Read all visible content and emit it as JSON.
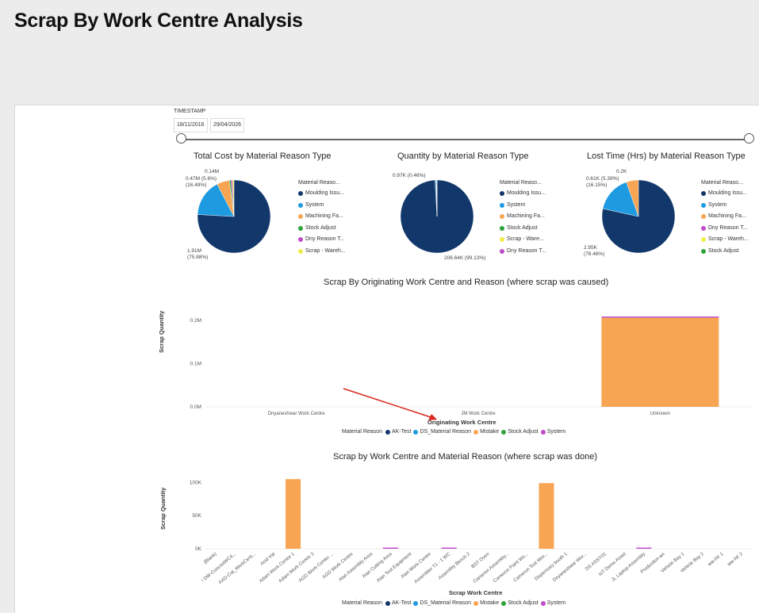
{
  "page": {
    "title": "Scrap By Work Centre Analysis"
  },
  "slicer": {
    "label": "TIMESTAMP",
    "start_date": "18/11/2016",
    "end_date": "29/04/2026"
  },
  "colors": {
    "dark_blue": "#12386b",
    "blue": "#1e9ae0",
    "orange": "#f7a552",
    "green": "#2ea33a",
    "purple": "#c04cc8",
    "yellow": "#f0ee4a",
    "arrow": "#d9281e"
  },
  "pies": [
    {
      "title": "Total Cost by Material Reason Type",
      "legend_title": "Material Reaso...",
      "legend": [
        {
          "label": "Moulding Issu...",
          "color": "#12386b"
        },
        {
          "label": "System",
          "color": "#1e9ae0"
        },
        {
          "label": "Machining Fa...",
          "color": "#f7a552"
        },
        {
          "label": "Stock Adjust",
          "color": "#2ea33a"
        },
        {
          "label": "Dny Reason T...",
          "color": "#c04cc8"
        },
        {
          "label": "Scrap - Wareh...",
          "color": "#f0ee4a"
        }
      ],
      "labels": {
        "top": "0.14M",
        "upper_1": "0.47M (5.6%)",
        "upper_2": "(16.48%)",
        "bottom_1": "1.91M",
        "bottom_2": "(75.88%)"
      }
    },
    {
      "title": "Quantity by Material Reason Type",
      "legend_title": "Material Reaso...",
      "legend": [
        {
          "label": "Moulding Issu...",
          "color": "#12386b"
        },
        {
          "label": "System",
          "color": "#1e9ae0"
        },
        {
          "label": "Machining Fa...",
          "color": "#f7a552"
        },
        {
          "label": "Stock Adjust",
          "color": "#2ea33a"
        },
        {
          "label": "Scrap - Ware...",
          "color": "#f0ee4a"
        },
        {
          "label": "Dny Reason T...",
          "color": "#c04cc8"
        }
      ],
      "labels": {
        "top": "0.97K (0.46%)",
        "bottom": "206.64K (99.13%)"
      }
    },
    {
      "title": "Lost Time (Hrs) by Material Reason Type",
      "legend_title": "Material Reaso...",
      "legend": [
        {
          "label": "Moulding Issu...",
          "color": "#12386b"
        },
        {
          "label": "System",
          "color": "#1e9ae0"
        },
        {
          "label": "Machining Fa...",
          "color": "#f7a552"
        },
        {
          "label": "Dny Reason T...",
          "color": "#c04cc8"
        },
        {
          "label": "Scrap - Wareh...",
          "color": "#f0ee4a"
        },
        {
          "label": "Stock Adjust",
          "color": "#2ea33a"
        }
      ],
      "labels": {
        "top": "0.2K",
        "upper_1": "0.61K (5.39%)",
        "upper_2": "(16.15%)",
        "bottom_1": "2.95K",
        "bottom_2": "(78.46%)"
      }
    }
  ],
  "chart_data": [
    {
      "type": "pie",
      "title": "Total Cost by Material Reason Type",
      "slices": [
        {
          "name": "Moulding Issu...",
          "value": 1.91,
          "percent": 75.88,
          "color": "#12386b"
        },
        {
          "name": "System",
          "value": 0.47,
          "percent": 16.48,
          "color": "#1e9ae0"
        },
        {
          "name": "Machining Fa...",
          "value": 0.14,
          "percent": 5.6,
          "color": "#f7a552"
        },
        {
          "name": "Stock Adjust",
          "value": 0.02,
          "percent": 0.7,
          "color": "#2ea33a"
        },
        {
          "name": "Dny Reason T...",
          "value": 0.02,
          "percent": 0.7,
          "color": "#c04cc8"
        },
        {
          "name": "Scrap - Wareh...",
          "value": 0.017,
          "percent": 0.64,
          "color": "#f0ee4a"
        }
      ]
    },
    {
      "type": "pie",
      "title": "Quantity by Material Reason Type",
      "slices": [
        {
          "name": "Moulding Issu...",
          "value": 206.64,
          "percent": 99.13,
          "color": "#12386b"
        },
        {
          "name": "System",
          "value": 0.97,
          "percent": 0.46,
          "color": "#1e9ae0"
        },
        {
          "name": "Machining Fa...",
          "value": 0.4,
          "percent": 0.19,
          "color": "#f7a552"
        },
        {
          "name": "Stock Adjust",
          "value": 0.3,
          "percent": 0.14,
          "color": "#2ea33a"
        },
        {
          "name": "Scrap - Ware...",
          "value": 0.1,
          "percent": 0.05,
          "color": "#f0ee4a"
        },
        {
          "name": "Dny Reason T...",
          "value": 0.05,
          "percent": 0.03,
          "color": "#c04cc8"
        }
      ]
    },
    {
      "type": "pie",
      "title": "Lost Time (Hrs) by Material Reason Type",
      "slices": [
        {
          "name": "Moulding Issu...",
          "value": 2.95,
          "percent": 78.46,
          "color": "#12386b"
        },
        {
          "name": "System",
          "value": 0.61,
          "percent": 16.15,
          "color": "#1e9ae0"
        },
        {
          "name": "Machining Fa...",
          "value": 0.2,
          "percent": 5.39,
          "color": "#f7a552"
        },
        {
          "name": "Dny Reason T...",
          "value": 0.0,
          "percent": 0.0,
          "color": "#c04cc8"
        },
        {
          "name": "Scrap - Wareh...",
          "value": 0.0,
          "percent": 0.0,
          "color": "#f0ee4a"
        },
        {
          "name": "Stock Adjust",
          "value": 0.0,
          "percent": 0.0,
          "color": "#2ea33a"
        }
      ]
    },
    {
      "type": "bar",
      "stacked": true,
      "title": "Scrap By Originating Work Centre and Reason (where scrap was caused)",
      "xlabel": "Originating Work Centre",
      "ylabel": "Scrap Quantity",
      "categories": [
        "Dnyaneshwar Work Centre",
        "JM Work Centre",
        "Unknown"
      ],
      "yticks": [
        "0.0M",
        "0.1M",
        "0.2M"
      ],
      "ylim": [
        0,
        0.22
      ],
      "legend_title": "Material Reason",
      "series": [
        {
          "name": "AK-Test",
          "color": "#12386b",
          "values": [
            0,
            0,
            0
          ]
        },
        {
          "name": "DS_Material Reason",
          "color": "#1e9ae0",
          "values": [
            0,
            0,
            0
          ]
        },
        {
          "name": "Mistake",
          "color": "#f7a552",
          "values": [
            0,
            0,
            0.206
          ]
        },
        {
          "name": "Stock Adjust",
          "color": "#2ea33a",
          "values": [
            0,
            0,
            0
          ]
        },
        {
          "name": "System",
          "color": "#c04cc8",
          "values": [
            0,
            0,
            0.002
          ]
        }
      ]
    },
    {
      "type": "bar",
      "stacked": true,
      "title": "Scrap by Work Centre and Material Reason (where scrap was done)",
      "xlabel": "Scrap Work Centre",
      "ylabel": "Scrap Quantity",
      "categories": [
        "(Blank)",
        "! DW-ConcretWC4...",
        "AAD-Cat_WorkCent...",
        "Acid Vat",
        "Adam Work Centre 1",
        "Adam Work Centre 3",
        "AGD Work Center ...",
        "AGD Work Centre",
        "Alan Assembly Area",
        "Alan Cutting Area",
        "Alan Test Equipment",
        "Alan Work Centre",
        "Assembler T1 - 1 WC",
        "Assembly Bench 2",
        "BST Oven",
        "Cameron Assembly...",
        "Cameron Paint Wo...",
        "Cameron Test Wor...",
        "Dispensary booth 1",
        "Dnyaneshwar Wor...",
        "DS ASSY01",
        "IoT Demo Asset",
        "JL Laptop Assembly",
        "Production wc",
        "Vehicle Bay 1",
        "Vehicle Bay 2",
        "ww AK 1",
        "ww AK 2"
      ],
      "yticks": [
        "0K",
        "50K",
        "100K"
      ],
      "ylim": [
        0,
        110
      ],
      "legend_title": "Material Reason",
      "series": [
        {
          "name": "AK-Test",
          "color": "#12386b",
          "values": [
            0,
            0,
            0,
            0,
            0,
            0,
            0,
            0,
            0,
            0,
            0,
            0,
            0,
            0,
            0,
            0,
            0,
            0,
            0,
            0,
            0,
            0,
            0,
            0,
            0,
            0,
            0,
            0
          ]
        },
        {
          "name": "DS_Material Reason",
          "color": "#1e9ae0",
          "values": [
            0,
            0,
            0,
            0,
            0,
            0,
            0,
            0,
            0,
            0,
            0,
            0,
            0,
            0,
            0,
            0,
            0,
            0,
            0,
            0,
            0,
            0,
            0,
            0,
            0,
            0,
            0,
            0
          ]
        },
        {
          "name": "Mistake",
          "color": "#f7a552",
          "values": [
            0,
            0,
            0,
            0,
            105,
            0,
            0,
            0,
            0,
            0,
            0,
            0,
            0,
            0,
            0,
            0,
            0,
            99,
            0,
            0,
            0,
            0,
            0,
            0,
            0,
            0,
            0,
            0
          ]
        },
        {
          "name": "Stock Adjust",
          "color": "#2ea33a",
          "values": [
            0,
            0,
            0,
            0,
            0,
            0,
            0,
            0,
            0,
            0,
            0,
            0,
            0,
            0,
            0,
            0,
            0,
            0,
            0,
            0,
            0,
            0,
            0,
            0,
            0,
            0,
            0,
            0
          ]
        },
        {
          "name": "System",
          "color": "#c04cc8",
          "values": [
            0,
            0,
            0,
            0,
            0,
            0,
            0,
            0,
            0,
            1,
            0,
            0,
            1,
            0,
            0,
            0,
            0,
            0,
            0,
            0,
            0,
            0,
            1,
            0,
            0,
            0,
            0,
            0
          ]
        }
      ]
    }
  ]
}
